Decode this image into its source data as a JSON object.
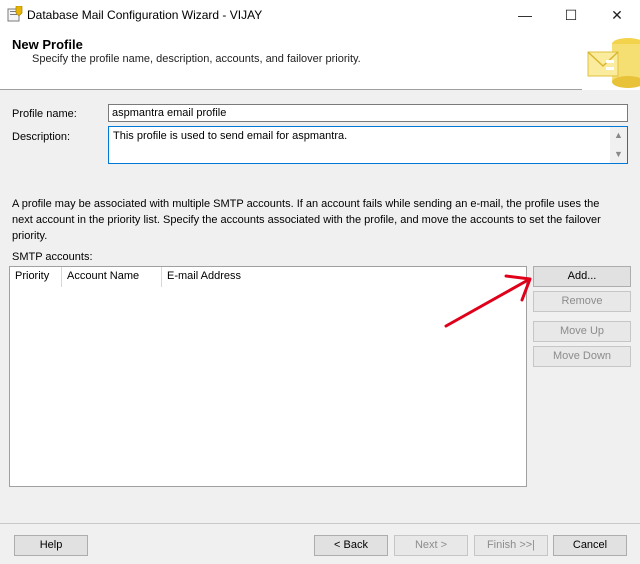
{
  "window": {
    "title": "Database Mail Configuration Wizard - VIJAY",
    "minimize_glyph": "—",
    "maximize_glyph": "☐",
    "close_glyph": "✕"
  },
  "header": {
    "title": "New Profile",
    "subtitle": "Specify the profile name, description, accounts, and failover priority."
  },
  "form": {
    "profile_name_label": "Profile name:",
    "profile_name_value": "aspmantra email profile",
    "description_label": "Description:",
    "description_value": "This profile is used to send email for aspmantra."
  },
  "info_text": "A profile may be associated with multiple SMTP accounts. If an account fails while sending an e-mail, the profile uses the next account in the priority list. Specify the accounts associated with the profile, and move the accounts to set the failover priority.",
  "smtp": {
    "label": "SMTP accounts:",
    "columns": [
      "Priority",
      "Account Name",
      "E-mail Address"
    ],
    "rows": []
  },
  "side_buttons": {
    "add": "Add...",
    "remove": "Remove",
    "move_up": "Move Up",
    "move_down": "Move Down"
  },
  "footer": {
    "help": "Help",
    "back": "< Back",
    "next": "Next >",
    "finish": "Finish >>|",
    "cancel": "Cancel"
  },
  "colors": {
    "annotation_arrow": "#e0001a",
    "focus_border": "#0078d7"
  }
}
